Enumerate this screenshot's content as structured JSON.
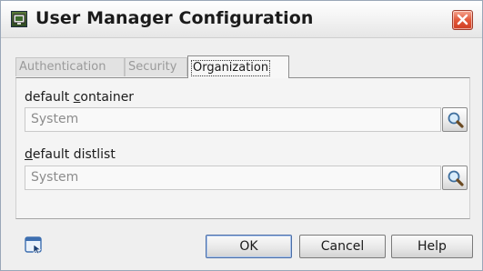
{
  "window": {
    "title": "User Manager Configuration"
  },
  "tabs": [
    {
      "label": "Authentication",
      "active": false
    },
    {
      "label": "Security",
      "active": false
    },
    {
      "label": "Organization",
      "active": true
    }
  ],
  "fields": {
    "container": {
      "label_prefix": "default ",
      "label_accel": "c",
      "label_rest": "ontainer",
      "value": "System"
    },
    "distlist": {
      "label_accel": "d",
      "label_rest": "efault distlist",
      "value": "System"
    }
  },
  "buttons": {
    "ok": "OK",
    "cancel": "Cancel",
    "help": "Help"
  },
  "colors": {
    "close_button": "#e2583a",
    "default_button_border": "#4b6ea6"
  }
}
